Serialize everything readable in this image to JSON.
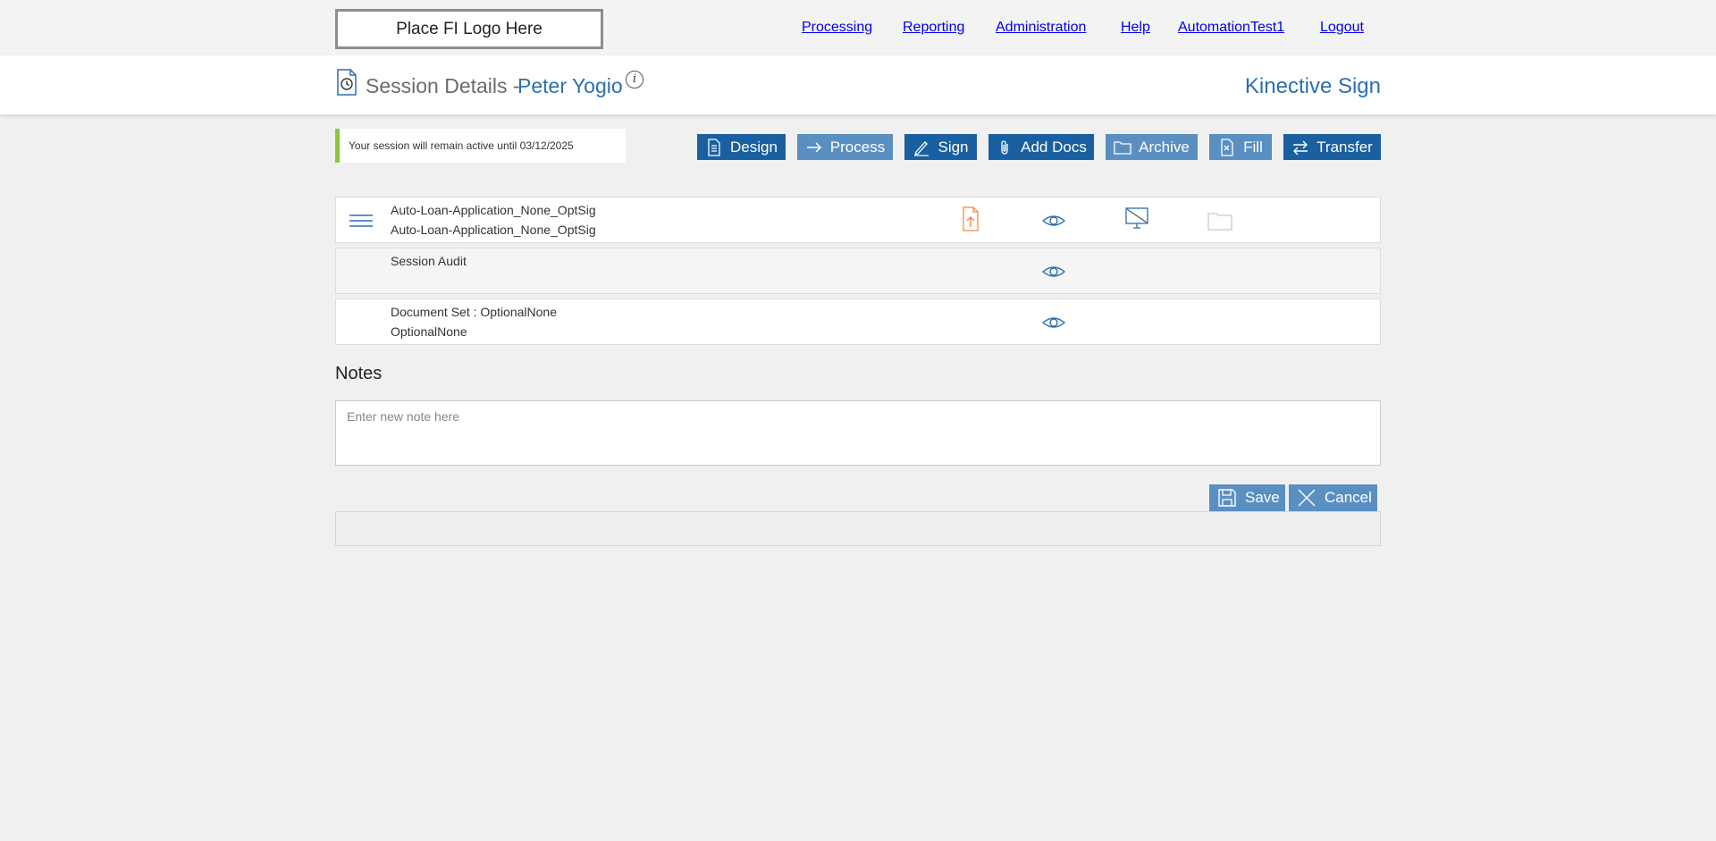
{
  "header": {
    "logo_text": "Place FI Logo Here",
    "nav": [
      "Processing",
      "Reporting",
      "Administration",
      "Help",
      "AutomationTest1",
      "Logout"
    ]
  },
  "title": {
    "label": "Session Details -",
    "client_name": "Peter Yogio",
    "brand": "Kinective Sign",
    "info_glyph": "i"
  },
  "session": {
    "message": "Your session will remain active until 03/12/2025"
  },
  "toolbar": {
    "design": "Design",
    "process": "Process",
    "sign": "Sign",
    "add_docs": "Add Docs",
    "archive": "Archive",
    "fill": "Fill",
    "transfer": "Transfer"
  },
  "documents": [
    {
      "line1": "Auto-Loan-Application_None_OptSig",
      "line2": "Auto-Loan-Application_None_OptSig"
    },
    {
      "line1": "Session Audit",
      "line2": ""
    },
    {
      "line1": "Document Set : OptionalNone",
      "line2": "OptionalNone"
    }
  ],
  "notes": {
    "title": "Notes",
    "placeholder": "Enter new note here",
    "save": "Save",
    "cancel": "Cancel"
  },
  "colors": {
    "primary": "#1a5fa0",
    "light_button": "#5a8fc2",
    "accent_green": "#8cc63f",
    "upload_orange": "#f08a4b",
    "link_blue": "#2d6fae"
  }
}
